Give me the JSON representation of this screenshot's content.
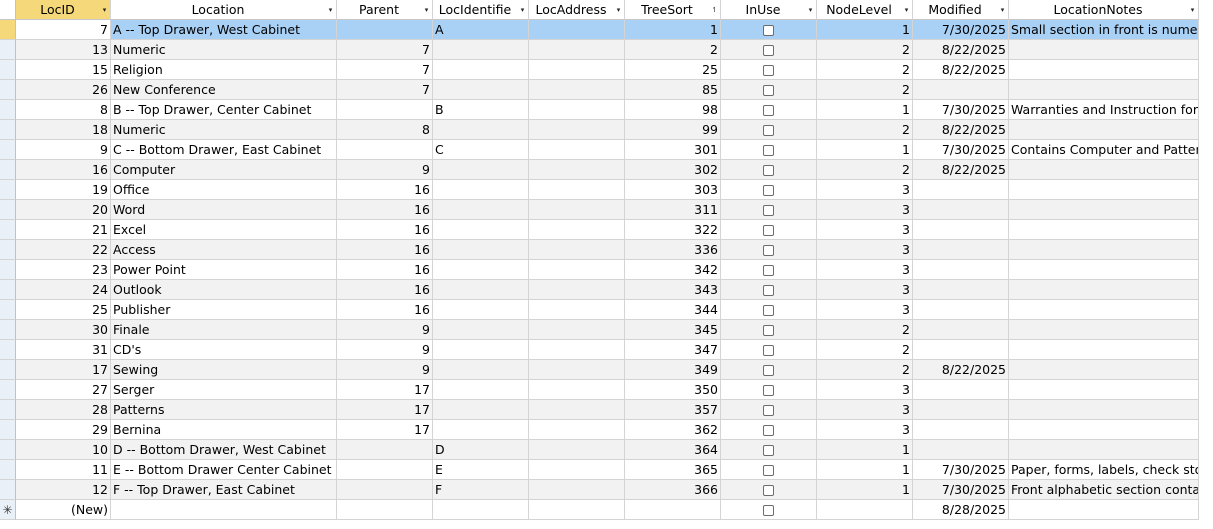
{
  "columns": [
    {
      "label": "LocID",
      "arrow": "▾"
    },
    {
      "label": "Location",
      "arrow": "▾"
    },
    {
      "label": "Parent",
      "arrow": "▾"
    },
    {
      "label": "LocIdentifie",
      "arrow": "▾"
    },
    {
      "label": "LocAddress",
      "arrow": "▾"
    },
    {
      "label": "TreeSort",
      "arrow": "↿"
    },
    {
      "label": "InUse",
      "arrow": "▾"
    },
    {
      "label": "NodeLevel",
      "arrow": "▾"
    },
    {
      "label": "Modified",
      "arrow": "▾"
    },
    {
      "label": "LocationNotes",
      "arrow": "▾"
    }
  ],
  "rows": [
    {
      "id": "7",
      "loc": "A -- Top Drawer, West Cabinet",
      "parent": "",
      "ident": "A",
      "addr": "",
      "sort": "1",
      "level": "1",
      "mod": "7/30/2025",
      "notes": "Small section in front is numer"
    },
    {
      "id": "13",
      "loc": "Numeric",
      "parent": "7",
      "ident": "",
      "addr": "",
      "sort": "2",
      "level": "2",
      "mod": "8/22/2025",
      "notes": ""
    },
    {
      "id": "15",
      "loc": "Religion",
      "parent": "7",
      "ident": "",
      "addr": "",
      "sort": "25",
      "level": "2",
      "mod": "8/22/2025",
      "notes": ""
    },
    {
      "id": "26",
      "loc": "New Conference",
      "parent": "7",
      "ident": "",
      "addr": "",
      "sort": "85",
      "level": "2",
      "mod": "",
      "notes": ""
    },
    {
      "id": "8",
      "loc": "B -- Top Drawer, Center Cabinet",
      "parent": "",
      "ident": "B",
      "addr": "",
      "sort": "98",
      "level": "1",
      "mod": "7/30/2025",
      "notes": "Warranties and Instruction for"
    },
    {
      "id": "18",
      "loc": "Numeric",
      "parent": "8",
      "ident": "",
      "addr": "",
      "sort": "99",
      "level": "2",
      "mod": "8/22/2025",
      "notes": ""
    },
    {
      "id": "9",
      "loc": "C -- Bottom Drawer, East Cabinet",
      "parent": "",
      "ident": "C",
      "addr": "",
      "sort": "301",
      "level": "1",
      "mod": "7/30/2025",
      "notes": "Contains Computer and Patter"
    },
    {
      "id": "16",
      "loc": "Computer",
      "parent": "9",
      "ident": "",
      "addr": "",
      "sort": "302",
      "level": "2",
      "mod": "8/22/2025",
      "notes": ""
    },
    {
      "id": "19",
      "loc": "Office",
      "parent": "16",
      "ident": "",
      "addr": "",
      "sort": "303",
      "level": "3",
      "mod": "",
      "notes": ""
    },
    {
      "id": "20",
      "loc": "Word",
      "parent": "16",
      "ident": "",
      "addr": "",
      "sort": "311",
      "level": "3",
      "mod": "",
      "notes": ""
    },
    {
      "id": "21",
      "loc": "Excel",
      "parent": "16",
      "ident": "",
      "addr": "",
      "sort": "322",
      "level": "3",
      "mod": "",
      "notes": ""
    },
    {
      "id": "22",
      "loc": "Access",
      "parent": "16",
      "ident": "",
      "addr": "",
      "sort": "336",
      "level": "3",
      "mod": "",
      "notes": ""
    },
    {
      "id": "23",
      "loc": "Power Point",
      "parent": "16",
      "ident": "",
      "addr": "",
      "sort": "342",
      "level": "3",
      "mod": "",
      "notes": ""
    },
    {
      "id": "24",
      "loc": "Outlook",
      "parent": "16",
      "ident": "",
      "addr": "",
      "sort": "343",
      "level": "3",
      "mod": "",
      "notes": ""
    },
    {
      "id": "25",
      "loc": "Publisher",
      "parent": "16",
      "ident": "",
      "addr": "",
      "sort": "344",
      "level": "3",
      "mod": "",
      "notes": ""
    },
    {
      "id": "30",
      "loc": "Finale",
      "parent": "9",
      "ident": "",
      "addr": "",
      "sort": "345",
      "level": "2",
      "mod": "",
      "notes": ""
    },
    {
      "id": "31",
      "loc": "CD's",
      "parent": "9",
      "ident": "",
      "addr": "",
      "sort": "347",
      "level": "2",
      "mod": "",
      "notes": ""
    },
    {
      "id": "17",
      "loc": "Sewing",
      "parent": "9",
      "ident": "",
      "addr": "",
      "sort": "349",
      "level": "2",
      "mod": "8/22/2025",
      "notes": ""
    },
    {
      "id": "27",
      "loc": "Serger",
      "parent": "17",
      "ident": "",
      "addr": "",
      "sort": "350",
      "level": "3",
      "mod": "",
      "notes": ""
    },
    {
      "id": "28",
      "loc": "Patterns",
      "parent": "17",
      "ident": "",
      "addr": "",
      "sort": "357",
      "level": "3",
      "mod": "",
      "notes": ""
    },
    {
      "id": "29",
      "loc": "Bernina",
      "parent": "17",
      "ident": "",
      "addr": "",
      "sort": "362",
      "level": "3",
      "mod": "",
      "notes": ""
    },
    {
      "id": "10",
      "loc": "D -- Bottom Drawer, West Cabinet",
      "parent": "",
      "ident": "D",
      "addr": "",
      "sort": "364",
      "level": "1",
      "mod": "",
      "notes": ""
    },
    {
      "id": "11",
      "loc": "E -- Bottom Drawer Center Cabinet",
      "parent": "",
      "ident": "E",
      "addr": "",
      "sort": "365",
      "level": "1",
      "mod": "7/30/2025",
      "notes": "Paper, forms, labels, check sto"
    },
    {
      "id": "12",
      "loc": "F -- Top Drawer, East Cabinet",
      "parent": "",
      "ident": "F",
      "addr": "",
      "sort": "366",
      "level": "1",
      "mod": "7/30/2025",
      "notes": "Front alphabetic section conta"
    }
  ],
  "new_row": {
    "id": "(New)",
    "marker": "✳",
    "mod": "8/28/2025"
  },
  "colors": {
    "selection": "#a9d0f5",
    "active_header": "#f5d87a",
    "alt_row": "#f2f2f2"
  }
}
